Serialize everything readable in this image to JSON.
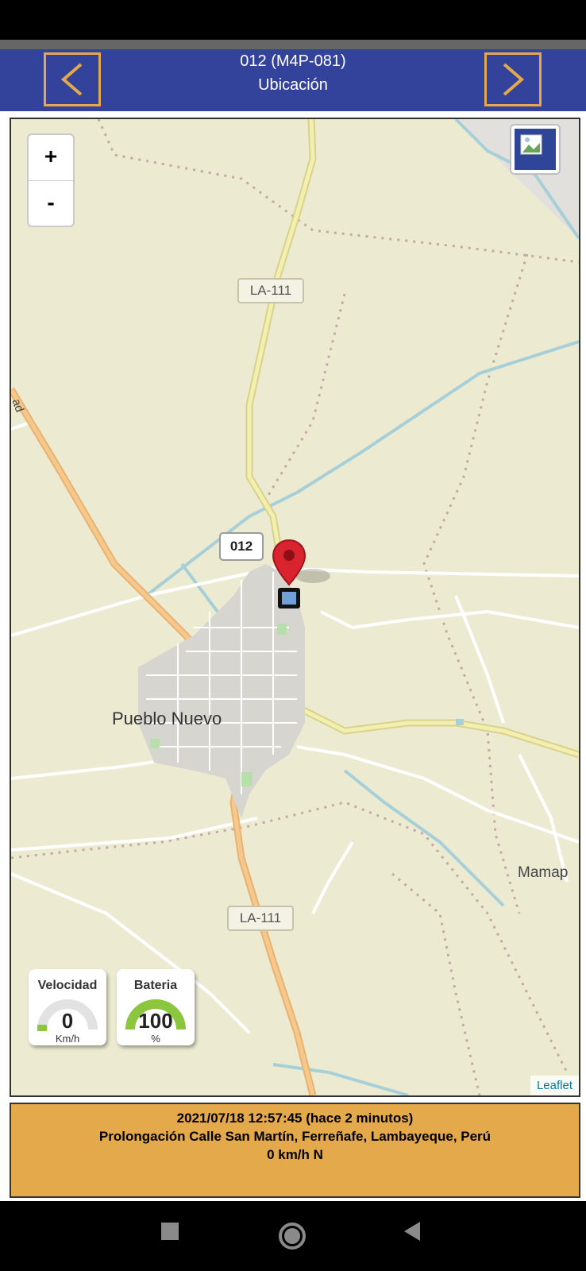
{
  "header": {
    "title": "012 (M4P-081)",
    "subtitle": "Ubicación",
    "prev_icon": "chevron-left-icon",
    "next_icon": "chevron-right-icon"
  },
  "map": {
    "zoom_in": "+",
    "zoom_out": "-",
    "layers_icon": "layers-icon",
    "road_labels": [
      "LA-111",
      "LA-111"
    ],
    "unit_label": "012",
    "places": {
      "town": "Pueblo Nuevo",
      "partial": "Mamap"
    },
    "edge_label": "ad",
    "attribution": "Leaflet",
    "marker_icon": "map-pin-icon"
  },
  "gauges": [
    {
      "title": "Velocidad",
      "value": "0",
      "unit": "Km/h",
      "fraction": 0.0
    },
    {
      "title": "Bateria",
      "value": "100",
      "unit": "%",
      "fraction": 1.0
    }
  ],
  "info": {
    "line1": "2021/07/18 12:57:45 (hace 2 minutos)",
    "line2": "Prolongación Calle San Martín, Ferreñafe, Lambayeque, Perú",
    "line3": "0 km/h N"
  },
  "colors": {
    "header_bg": "#33429a",
    "accent": "#e3a94a",
    "map_bg": "#ecebd2",
    "gauge_green": "#8cc63f",
    "marker_red": "#d9232e"
  }
}
